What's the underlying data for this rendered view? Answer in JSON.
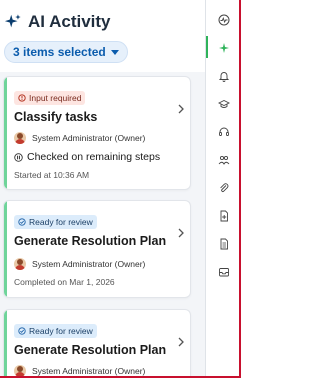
{
  "panel": {
    "title": "AI Activity",
    "selector_label": "3 items selected"
  },
  "cards": [
    {
      "badge": "Input required",
      "badge_kind": "warn",
      "title": "Classify tasks",
      "owner": "System Administrator (Owner)",
      "status": "Checked on remaining steps",
      "meta": "Started at 10:36 AM"
    },
    {
      "badge": "Ready for review",
      "badge_kind": "ok",
      "title": "Generate Resolution Plan",
      "owner": "System Administrator (Owner)",
      "meta": "Completed on Mar 1, 2026"
    },
    {
      "badge": "Ready for review",
      "badge_kind": "ok",
      "title": "Generate Resolution Plan",
      "owner": "System Administrator (Owner)"
    }
  ],
  "rail_icons": [
    "activity-icon",
    "ai-sparkle-icon",
    "bell-icon",
    "graduation-cap-icon",
    "headset-icon",
    "people-icon",
    "paperclip-icon",
    "document-add-icon",
    "document-icon",
    "inbox-icon"
  ],
  "colors": {
    "accent": "#0b5cad",
    "stripe": "#6fd49a",
    "warn_badge_bg": "#fde5e1",
    "ok_badge_bg": "#dcecfb",
    "rail_active": "#2fb35a",
    "frame_border": "#c8102e"
  }
}
